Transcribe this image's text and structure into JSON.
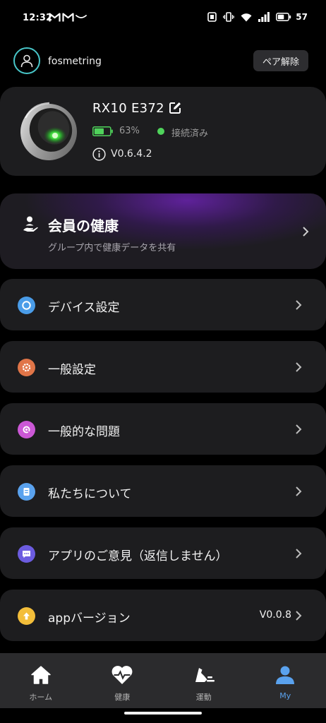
{
  "status_bar": {
    "time": "12:32",
    "battery_level": "57",
    "icons": [
      "gmail-icon",
      "gmail-icon",
      "dash-icon",
      "nfc-icon",
      "vibrate-icon",
      "wifi-icon",
      "signal-icon",
      "battery-icon"
    ]
  },
  "profile": {
    "username": "fosmetring",
    "unpair_label": "ペア解除"
  },
  "device": {
    "name": "RX10 E372",
    "battery_percent": "63%",
    "battery_fraction": 0.63,
    "connection_status": "接続済み",
    "firmware_version": "V0.6.4.2"
  },
  "member_health": {
    "title": "会員の健康",
    "subtitle": "グループ内で健康データを共有"
  },
  "menu": {
    "items": [
      {
        "label": "デバイス設定",
        "icon": "device-settings-icon",
        "color": "#4a9ce8"
      },
      {
        "label": "一般設定",
        "icon": "general-settings-icon",
        "color": "#e07548"
      },
      {
        "label": "一般的な問題",
        "icon": "faq-icon",
        "color": "#cb58d6"
      },
      {
        "label": "私たちについて",
        "icon": "about-icon",
        "color": "#5aa2ee"
      },
      {
        "label": "アプリのご意見（返信しません）",
        "icon": "feedback-icon",
        "color": "#6c5ce0"
      },
      {
        "label": "appバージョン",
        "icon": "app-version-icon",
        "color": "#f3be3a",
        "value": "V0.0.8"
      }
    ]
  },
  "bottom_nav": {
    "items": [
      {
        "label": "ホーム",
        "icon": "home-icon",
        "active": false
      },
      {
        "label": "健康",
        "icon": "heart-icon",
        "active": false
      },
      {
        "label": "運動",
        "icon": "shoe-icon",
        "active": false
      },
      {
        "label": "My",
        "icon": "person-icon",
        "active": true
      }
    ]
  },
  "colors": {
    "background": "#000000",
    "card": "#1d1d1f",
    "accent_blue": "#5aa2ee",
    "connected_green": "#4fd35b",
    "avatar_ring": "#48c6c9"
  }
}
